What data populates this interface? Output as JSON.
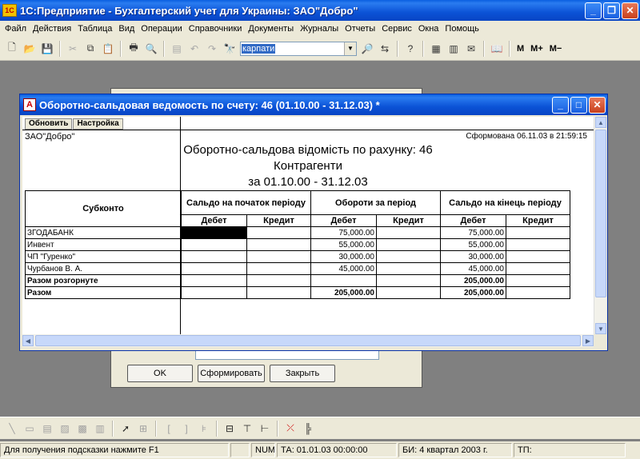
{
  "app": {
    "title": "1С:Предприятие - Бухгалтерский учет для Украины: ЗАО\"Добро\"",
    "icon": "1C"
  },
  "menu": [
    "Файл",
    "Действия",
    "Таблица",
    "Вид",
    "Операции",
    "Справочники",
    "Документы",
    "Журналы",
    "Отчеты",
    "Сервис",
    "Окна",
    "Помощь"
  ],
  "toolbar": {
    "search_value": "карпати",
    "btn_m": "M",
    "btn_mplus": "M+",
    "btn_mminus": "M−"
  },
  "dialog": {
    "ok": "OK",
    "form": "Сформировать",
    "close": "Закрыть"
  },
  "report": {
    "window_title": "Оборотно-сальдовая ведомость по счету: 46 (01.10.00 - 31.12.03)  *",
    "btn_refresh": "Обновить",
    "btn_settings": "Настройка",
    "org": "ЗАО\"Добро\"",
    "formed": "Сформована 06.11.03 в 21:59:15",
    "title1": "Оборотно-сальдова відомість по рахунку: 46",
    "title2": "Контрагенти",
    "title3": "за 01.10.00 - 31.12.03",
    "col_subconto": "Субконто",
    "col_start": "Сальдо на початок періоду",
    "col_turnover": "Обороти за період",
    "col_end": "Сальдо на кінець періоду",
    "debit": "Дебет",
    "credit": "Кредит",
    "rows": [
      {
        "name": "ЗГОДАБАНК",
        "sd": "",
        "sc": "",
        "td": "75,000.00",
        "tc": "",
        "ed": "75,000.00",
        "ec": ""
      },
      {
        "name": "Инвент",
        "sd": "",
        "sc": "",
        "td": "55,000.00",
        "tc": "",
        "ed": "55,000.00",
        "ec": ""
      },
      {
        "name": "ЧП \"Гуренко\"",
        "sd": "",
        "sc": "",
        "td": "30,000.00",
        "tc": "",
        "ed": "30,000.00",
        "ec": ""
      },
      {
        "name": "Чурбанов В. А.",
        "sd": "",
        "sc": "",
        "td": "45,000.00",
        "tc": "",
        "ed": "45,000.00",
        "ec": ""
      }
    ],
    "total_expanded": {
      "name": "Разом розгорнуте",
      "ed": "205,000.00"
    },
    "total": {
      "name": "Разом",
      "td": "205,000.00",
      "ed": "205,000.00"
    }
  },
  "status": {
    "hint": "Для получения подсказки нажмите F1",
    "num": "NUM",
    "ta": "ТА: 01.01.03  00:00:00",
    "bi": "БИ: 4 квартал 2003 г.",
    "tp": "ТП:"
  }
}
